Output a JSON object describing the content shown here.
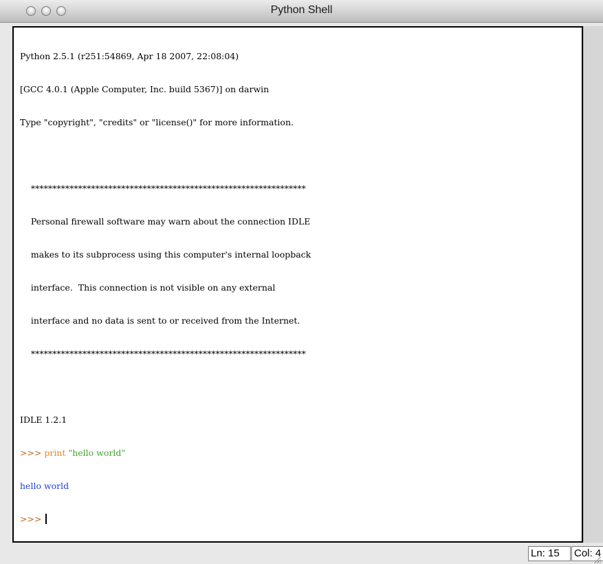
{
  "window": {
    "title": "Python Shell"
  },
  "shell": {
    "lines": [
      "Python 2.5.1 (r251:54869, Apr 18 2007, 22:08:04)",
      "[GCC 4.0.1 (Apple Computer, Inc. build 5367)] on darwin",
      "Type \"copyright\", \"credits\" or \"license()\" for more information.",
      "",
      "    ****************************************************************",
      "    Personal firewall software may warn about the connection IDLE",
      "    makes to its subprocess using this computer's internal loopback",
      "    interface.  This connection is not visible on any external",
      "    interface and no data is sent to or received from the Internet.",
      "    ****************************************************************",
      "",
      "IDLE 1.2.1"
    ],
    "command": {
      "prompt": ">>> ",
      "keyword": "print",
      "space": " ",
      "string": "\"hello world\""
    },
    "output": "hello world",
    "current_prompt": ">>> "
  },
  "status": {
    "ln": "Ln: 15",
    "col": "Col: 4"
  },
  "colors": {
    "prompt": "#c55f16",
    "keyword": "#e88a1f",
    "string": "#3fa72c",
    "output": "#1f3fd6"
  },
  "icons": {
    "close": "close-traffic-light-icon",
    "minimize": "minimize-traffic-light-icon",
    "zoom": "zoom-traffic-light-icon",
    "resize": "resize-grip-icon"
  }
}
